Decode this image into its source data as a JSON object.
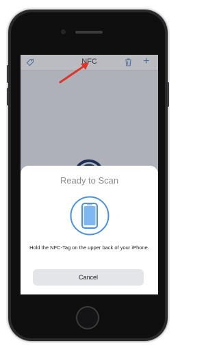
{
  "nav": {
    "title": "NFC",
    "icons": [
      "tag-icon",
      "trash-icon",
      "plus-icon"
    ],
    "plus_glyph": "+"
  },
  "sheet": {
    "title": "Ready to Scan",
    "message": "Hold the NFC-Tag on the upper back of your iPhone.",
    "cancel_label": "Cancel"
  },
  "colors": {
    "accent": "#4a90e2",
    "annotation_arrow": "#e0342a",
    "sheet_background": "#ffffff"
  }
}
